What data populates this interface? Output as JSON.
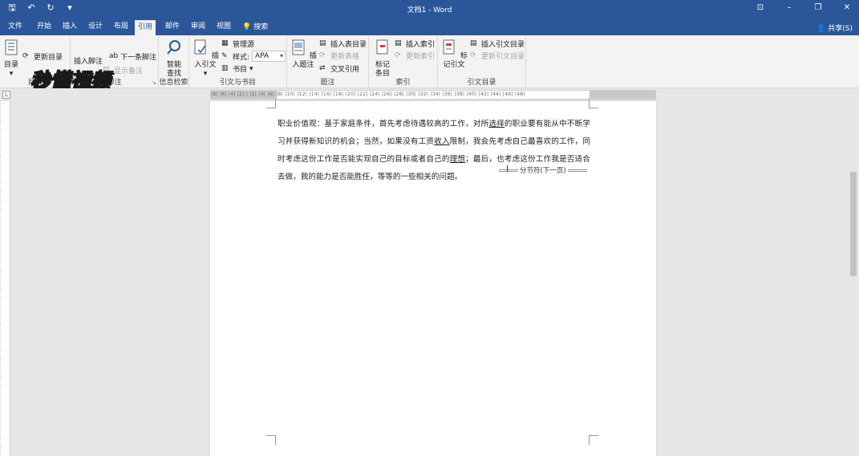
{
  "window": {
    "title": "文档1 - Word",
    "share_label": "共享(S)"
  },
  "tabs": [
    {
      "label": "文件"
    },
    {
      "label": "开始"
    },
    {
      "label": "插入"
    },
    {
      "label": "设计"
    },
    {
      "label": "布局"
    },
    {
      "label": "引用",
      "active": true
    },
    {
      "label": "邮件"
    },
    {
      "label": "审阅"
    },
    {
      "label": "视图"
    }
  ],
  "search": {
    "label": "搜索"
  },
  "ribbon": {
    "toc": {
      "button": "目录",
      "update": "更新目录",
      "group": "目录"
    },
    "footnotes": {
      "insert_footnote": "插入脚注",
      "next_footnote": "下一条脚注",
      "show_notes": "显示备注",
      "group": "脚注"
    },
    "research": {
      "smart_lookup_1": "智能",
      "smart_lookup_2": "查找",
      "group": "信息检索"
    },
    "citations": {
      "insert_citation": "插入引文",
      "manage_sources": "管理源",
      "style_label": "样式:",
      "style_value": "APA",
      "bibliography": "书目",
      "group": "引文与书目"
    },
    "captions": {
      "insert_caption": "插入题注",
      "insert_table_of_figures": "插入表目录",
      "update_table": "更新表格",
      "cross_reference": "交叉引用",
      "group": "题注"
    },
    "index": {
      "mark_entry_1": "标记",
      "mark_entry_2": "条目",
      "insert_index": "插入索引",
      "update_index": "更新索引",
      "group": "索引"
    },
    "table_of_authorities": {
      "mark_citation": "标记引文",
      "insert_toa": "插入引文目录",
      "update_toa": "更新引文目录",
      "group": "引文目录"
    }
  },
  "ruler": {
    "ticks": "|8| |6| |4| |2| | |2| |4| |6| |8| |10| |12| |14| |16| |18| |20| |22| |24| |26| |28| |30| |32| |34| |36| |38| |40| |42| |44| |46| |48|"
  },
  "document": {
    "para_part1": "职业价值观：基于家庭条件，首先考虑待遇较高的工作，对所",
    "link1": "选择",
    "para_part2": "的职业要有能从中不断学习并获得新知识的机会；当然，如果没有工资",
    "link2": "收入",
    "para_part3": "限制，我会先考虑自己最喜欢的工作，同时考虑这份工作是否能实现自己的目标或者自己的",
    "link3": "理想",
    "para_part4": "；最后，也考虑这份工作我是否适合去做，我的能力是否能胜任，等等的一些相关的问题。",
    "section_break": "分节符(下一页)"
  },
  "watermark": {
    "text": "秒懂视频"
  }
}
